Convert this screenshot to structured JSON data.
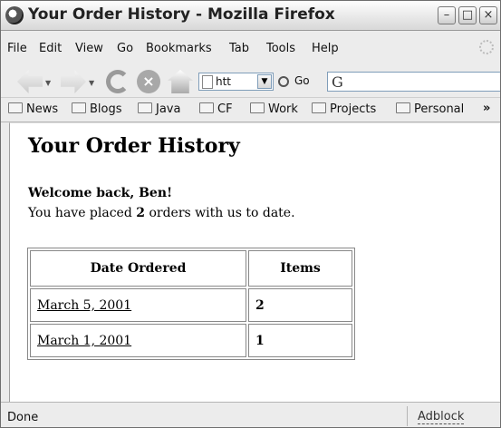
{
  "window": {
    "title": "Your Order History - Mozilla Firefox",
    "controls": {
      "minimize": "–",
      "maximize": "□",
      "close": "×"
    }
  },
  "menubar": {
    "items": [
      "File",
      "Edit",
      "View",
      "Go",
      "Bookmarks",
      "Tab",
      "Tools",
      "Help"
    ]
  },
  "navbar": {
    "url_text": "htt",
    "go_label": "Go",
    "search_engine_glyph": "G",
    "icons": [
      "back-icon",
      "forward-icon",
      "reload-icon",
      "stop-icon",
      "home-icon",
      "page-icon",
      "go-icon",
      "google-icon"
    ]
  },
  "bookmarks": {
    "items": [
      "News",
      "Blogs",
      "Java",
      "CF",
      "Work",
      "Projects",
      "Personal"
    ],
    "overflow": "»"
  },
  "page": {
    "title": "Your Order History",
    "welcome": "Welcome back, Ben!",
    "summary_before": "You have placed",
    "order_count": "2",
    "summary_after": "orders with us to date.",
    "table": {
      "headers": [
        "Date Ordered",
        "Items"
      ],
      "rows": [
        {
          "date": "March 5, 2001",
          "items": "2"
        },
        {
          "date": "March 1, 2001",
          "items": "1"
        }
      ]
    }
  },
  "statusbar": {
    "text": "Done",
    "adblock": "Adblock"
  }
}
